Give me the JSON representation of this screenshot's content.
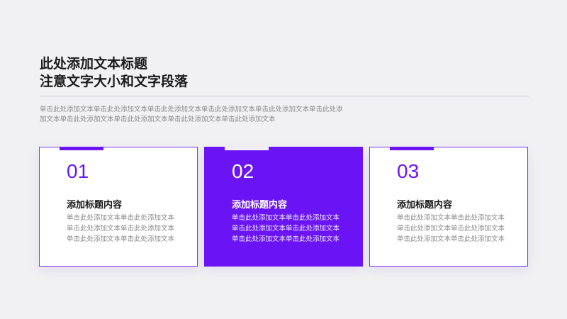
{
  "title": {
    "line1": "此处添加文本标题",
    "line2": "注意文字大小和文字段落"
  },
  "intro": {
    "line1": "单击此处添加文本单击此处添加文本单击此处添加文本单击此处添加文本单击此处添加文本单击此处添",
    "line2": "加文本单击此处添加文本单击此处添加文本单击此处添加文本单击此处添加文本"
  },
  "cards": [
    {
      "number": "01",
      "heading": "添加标题内容",
      "lines": [
        "单击此处添加文本单击此处添加文本",
        "单击此处添加文本单击此处添加文本",
        "单击此处添加文本单击此处添加文本"
      ],
      "active": false
    },
    {
      "number": "02",
      "heading": "添加标题内容",
      "lines": [
        "单击此处添加文本单击此处添加文本",
        "单击此处添加文本单击此处添加文本",
        "单击此处添加文本单击此处添加文本"
      ],
      "active": true
    },
    {
      "number": "03",
      "heading": "添加标题内容",
      "lines": [
        "单击此处添加文本单击此处添加文本",
        "单击此处添加文本单击此处添加文本",
        "单击此处添加文本单击此处添加文本"
      ],
      "active": false
    }
  ],
  "colors": {
    "accent": "#6a14f5",
    "background": "#f1f1f3",
    "text_dark": "#1a1a1a",
    "text_muted": "#8a8a8a"
  }
}
